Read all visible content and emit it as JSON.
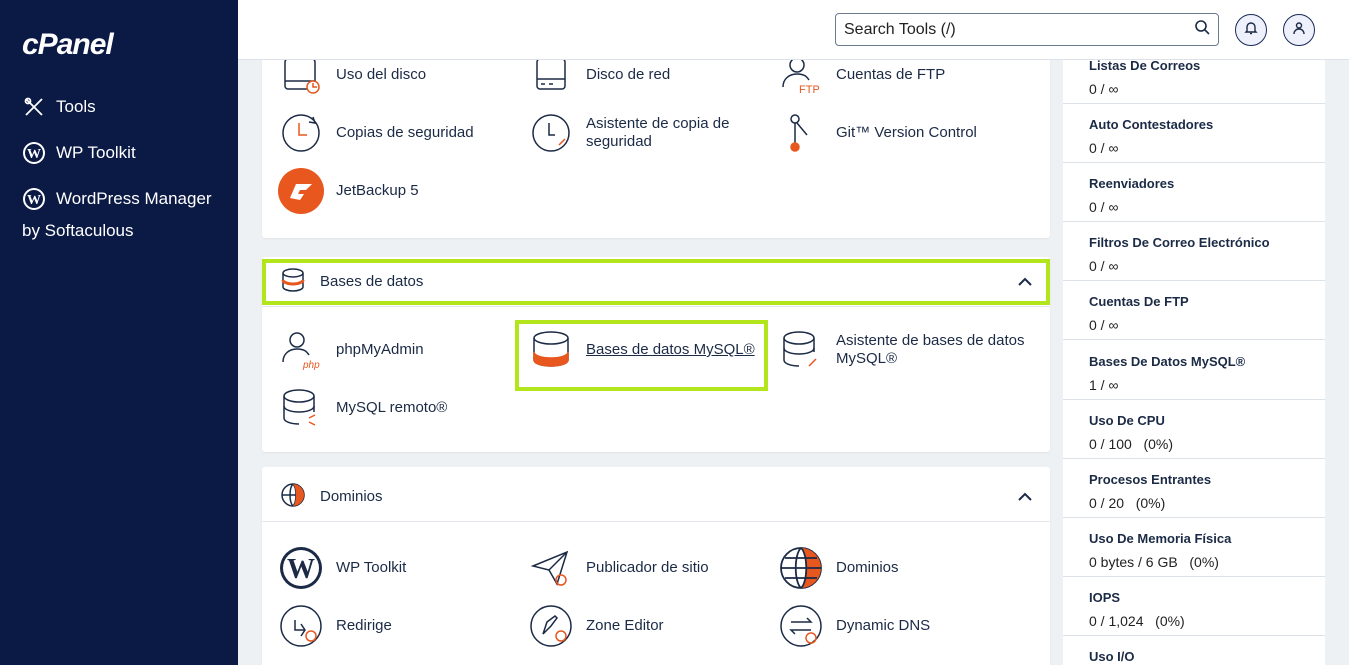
{
  "sidebar": {
    "logo": "cPanel",
    "items": [
      {
        "label": "Tools"
      },
      {
        "label": "WP Toolkit"
      },
      {
        "label": "WordPress Manager"
      }
    ],
    "sub_label": "by Softaculous"
  },
  "header": {
    "search_placeholder": "Search Tools (/)"
  },
  "files_section": {
    "tools": [
      {
        "label": "Uso del disco"
      },
      {
        "label": "Disco de red"
      },
      {
        "label": "Cuentas de FTP"
      },
      {
        "label": "Copias de seguridad"
      },
      {
        "label": "Asistente de copia de seguridad"
      },
      {
        "label": "Git™ Version Control"
      },
      {
        "label": "JetBackup 5"
      }
    ]
  },
  "databases_section": {
    "title": "Bases de datos",
    "tools": [
      {
        "label": "phpMyAdmin"
      },
      {
        "label": "Bases de datos MySQL®"
      },
      {
        "label": "Asistente de bases de datos MySQL®"
      },
      {
        "label": "MySQL remoto®"
      }
    ]
  },
  "domains_section": {
    "title": "Dominios",
    "tools": [
      {
        "label": "WP Toolkit"
      },
      {
        "label": "Publicador de sitio"
      },
      {
        "label": "Dominios"
      },
      {
        "label": "Redirige"
      },
      {
        "label": "Zone Editor"
      },
      {
        "label": "Dynamic DNS"
      }
    ]
  },
  "stats": [
    {
      "label": "Listas De Correos",
      "value": "0 / ∞"
    },
    {
      "label": "Auto Contestadores",
      "value": "0 / ∞"
    },
    {
      "label": "Reenviadores",
      "value": "0 / ∞"
    },
    {
      "label": "Filtros De Correo Electrónico",
      "value": "0 / ∞"
    },
    {
      "label": "Cuentas De FTP",
      "value": "0 / ∞"
    },
    {
      "label": "Bases De Datos MySQL®",
      "value": "1 / ∞"
    },
    {
      "label": "Uso De CPU",
      "value": "0 / 100   (0%)"
    },
    {
      "label": "Procesos Entrantes",
      "value": "0 / 20   (0%)"
    },
    {
      "label": "Uso De Memoria Física",
      "value": "0 bytes / 6 GB   (0%)"
    },
    {
      "label": "IOPS",
      "value": "0 / 1,024   (0%)"
    },
    {
      "label": "Uso I/O",
      "value": ""
    }
  ],
  "colors": {
    "sidebar_bg": "#0b1a45",
    "accent_orange": "#e8571e",
    "highlight": "#b3e51c"
  }
}
